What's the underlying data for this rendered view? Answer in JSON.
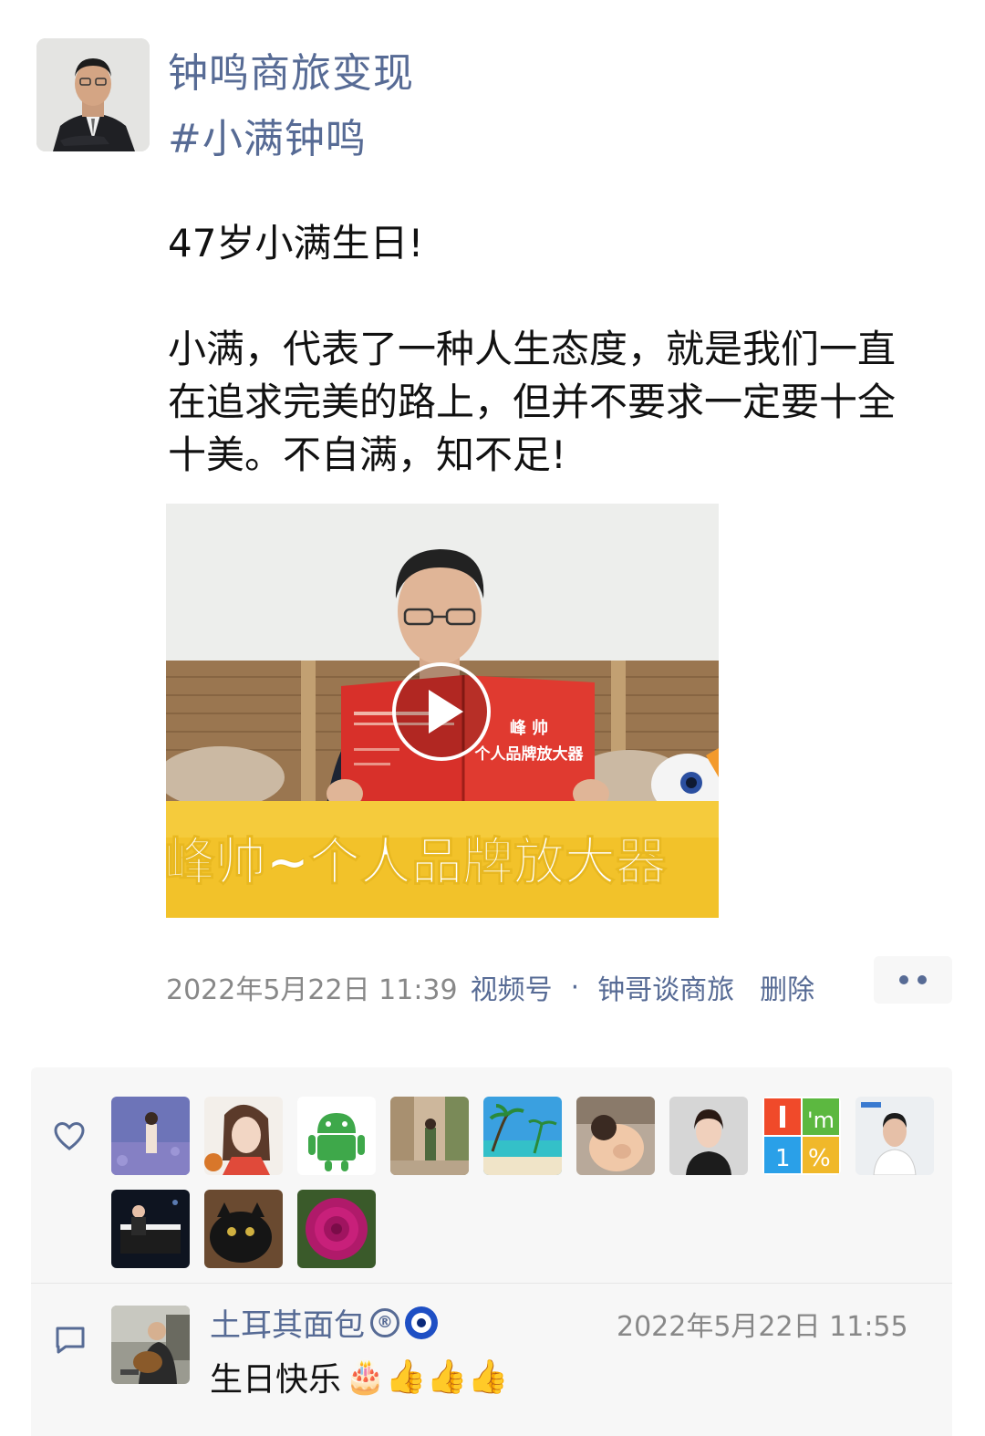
{
  "post": {
    "author_name": "钟鸣商旅变现",
    "hashtag": "#小满钟鸣",
    "text": "47岁小满生日!\n\n小满，代表了一种人生态度，就是我们一直在追求完美的路上，但并不要求一定要十全十美。不自满，知不足!"
  },
  "video": {
    "caption": "峰帅~个人品牌放大器",
    "book_title": "个人品牌放大器",
    "book_author": "峰 帅",
    "play_icon": "play-icon"
  },
  "meta": {
    "timestamp": "2022年5月22日 11:39",
    "source_label": "视频号",
    "separator": "·",
    "channel_name": "钟哥谈商旅",
    "delete_label": "删除"
  },
  "likes": {
    "icon": "heart-icon",
    "count_avatars": 12
  },
  "comment": {
    "icon": "comment-icon",
    "author": "土耳其面包",
    "author_badge": "®",
    "timestamp": "2022年5月22日 11:55",
    "text": "生日快乐",
    "emojis": "🎂👍👍👍"
  },
  "colors": {
    "link": "#576b95",
    "meta_gray": "#888888",
    "panel_bg": "#f7f7f7",
    "caption_band": "#f2c22a",
    "book_red": "#d8302a"
  }
}
